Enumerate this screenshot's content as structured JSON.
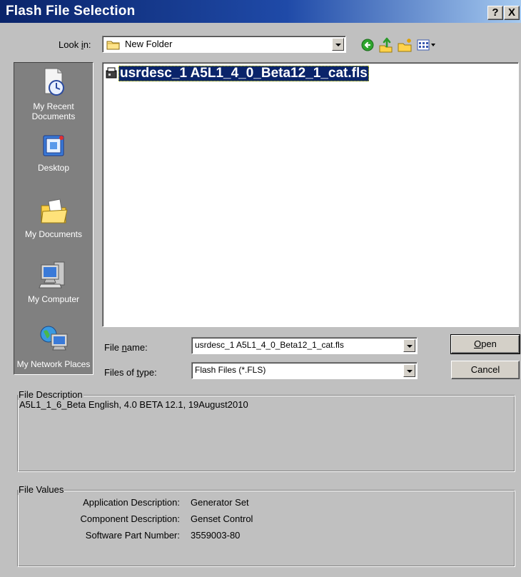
{
  "window": {
    "title": "Flash File Selection",
    "help_glyph": "?",
    "close_glyph": "X"
  },
  "look_in": {
    "label_pre": "Look ",
    "label_u": "i",
    "label_post": "n:",
    "value": "New Folder"
  },
  "toolbar": {
    "icons": [
      "back-icon",
      "up-folder-icon",
      "new-folder-icon",
      "view-menu-icon"
    ]
  },
  "places": {
    "items": [
      {
        "id": "recent",
        "label": "My Recent Documents"
      },
      {
        "id": "desktop",
        "label": "Desktop"
      },
      {
        "id": "mydocs",
        "label": "My Documents"
      },
      {
        "id": "mycomputer",
        "label": "My Computer"
      },
      {
        "id": "network",
        "label": "My Network Places"
      }
    ]
  },
  "file_list": {
    "items": [
      {
        "name": "usrdesc_1 A5L1_4_0_Beta12_1_cat.fls",
        "selected": true
      }
    ]
  },
  "file_name": {
    "label_pre": "File ",
    "label_u": "n",
    "label_post": "ame:",
    "value": "usrdesc_1 A5L1_4_0_Beta12_1_cat.fls"
  },
  "file_type": {
    "label_pre": "Files of ",
    "label_u": "t",
    "label_post": "ype:",
    "value": "Flash Files (*.FLS)"
  },
  "buttons": {
    "open_u": "O",
    "open_post": "pen",
    "cancel": "Cancel"
  },
  "file_description": {
    "legend": "File Description",
    "text": "A5L1_1_6_Beta English, 4.0 BETA 12.1, 19August2010"
  },
  "file_values": {
    "legend": "File Values",
    "rows": [
      {
        "key": "Application Description:",
        "value": "Generator Set"
      },
      {
        "key": "Component Description:",
        "value": "Genset Control"
      },
      {
        "key": "Software Part Number:",
        "value": "3559003-80"
      }
    ]
  },
  "colors": {
    "title_bar": "#0a246a",
    "selection": "#0a246a",
    "dialog_bg": "#c0c0c0",
    "places_bar": "#808080"
  }
}
